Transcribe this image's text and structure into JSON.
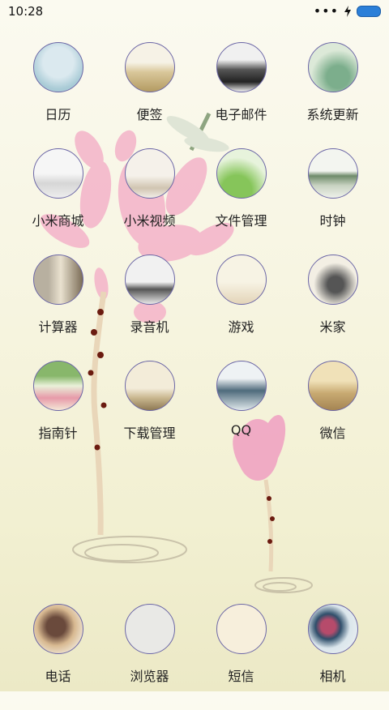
{
  "status_bar": {
    "time": "10:28",
    "menu_dots": "•••"
  },
  "apps": [
    {
      "label": "日历",
      "icon": "calendar-icon"
    },
    {
      "label": "便签",
      "icon": "notes-icon"
    },
    {
      "label": "电子邮件",
      "icon": "email-icon"
    },
    {
      "label": "系统更新",
      "icon": "system-update-icon"
    },
    {
      "label": "小米商城",
      "icon": "mi-store-icon"
    },
    {
      "label": "小米视频",
      "icon": "mi-video-icon"
    },
    {
      "label": "文件管理",
      "icon": "file-manager-icon"
    },
    {
      "label": "时钟",
      "icon": "clock-icon"
    },
    {
      "label": "计算器",
      "icon": "calculator-icon"
    },
    {
      "label": "录音机",
      "icon": "recorder-icon"
    },
    {
      "label": "游戏",
      "icon": "games-icon"
    },
    {
      "label": "米家",
      "icon": "mijia-icon"
    },
    {
      "label": "指南针",
      "icon": "compass-icon"
    },
    {
      "label": "下载管理",
      "icon": "downloads-icon"
    },
    {
      "label": "QQ",
      "icon": "qq-icon"
    },
    {
      "label": "微信",
      "icon": "wechat-icon"
    }
  ],
  "dock": [
    {
      "label": "电话",
      "icon": "phone-icon"
    },
    {
      "label": "浏览器",
      "icon": "browser-icon"
    },
    {
      "label": "短信",
      "icon": "messages-icon"
    },
    {
      "label": "相机",
      "icon": "camera-icon"
    }
  ],
  "colors": {
    "battery": "#2b7fd8",
    "icon_border": "#6b66a6",
    "background": "#f7f5e2"
  }
}
